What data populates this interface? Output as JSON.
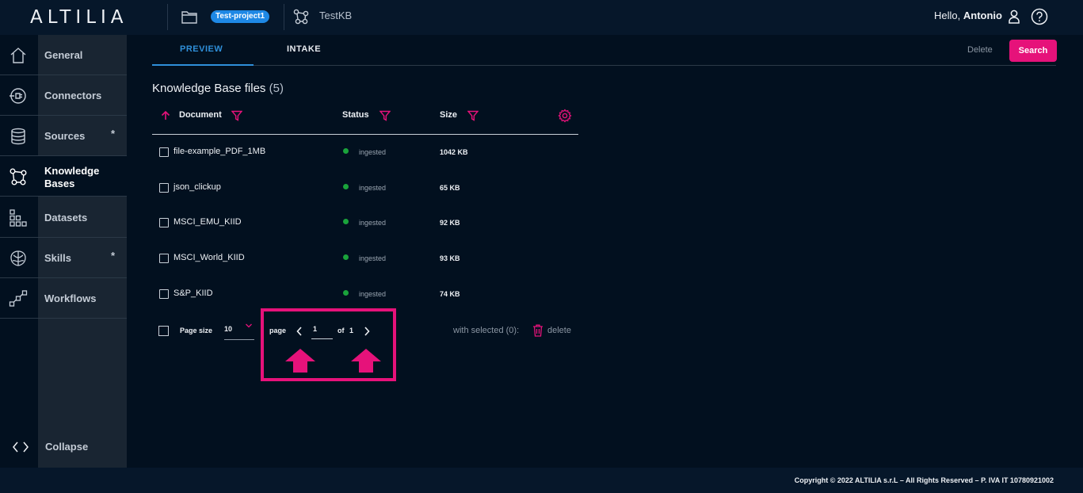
{
  "header": {
    "logo": "ALTILIA",
    "project_badge": "Test-project1",
    "kb_name": "TestKB",
    "greeting": "Hello,",
    "user_name": "Antonio"
  },
  "sidebar": {
    "items": [
      {
        "label": "General",
        "icon": "home-icon",
        "star": ""
      },
      {
        "label": "Connectors",
        "icon": "plug-icon",
        "star": ""
      },
      {
        "label": "Sources",
        "icon": "database-icon",
        "star": "*"
      },
      {
        "label": "Knowledge Bases",
        "icon": "graph-nodes-icon",
        "star": ""
      },
      {
        "label": "Datasets",
        "icon": "grid-icon",
        "star": ""
      },
      {
        "label": "Skills",
        "icon": "brain-icon",
        "star": "*"
      },
      {
        "label": "Workflows",
        "icon": "workflow-icon",
        "star": ""
      }
    ],
    "active_index": 3,
    "collapse_label": "Collapse"
  },
  "tabs": [
    {
      "label": "PREVIEW",
      "active": true
    },
    {
      "label": "INTAKE",
      "active": false
    }
  ],
  "toolbar": {
    "delete_label": "Delete",
    "search_label": "Search"
  },
  "table": {
    "title": "Knowledge Base files",
    "count": "(5)",
    "columns": {
      "document": "Document",
      "status": "Status",
      "size": "Size"
    },
    "rows": [
      {
        "document": "file-example_PDF_1MB",
        "status": "ingested",
        "size": "1042 KB"
      },
      {
        "document": "json_clickup",
        "status": "ingested",
        "size": "65 KB"
      },
      {
        "document": "MSCI_EMU_KIID",
        "status": "ingested",
        "size": "92 KB"
      },
      {
        "document": "MSCI_World_KIID",
        "status": "ingested",
        "size": "93 KB"
      },
      {
        "document": "S&P_KIID",
        "status": "ingested",
        "size": "74 KB"
      }
    ]
  },
  "pagination": {
    "page_size_label": "Page size",
    "page_size": "10",
    "page_label": "page",
    "current_page": "1",
    "of_label": "of",
    "total_pages": "1",
    "with_selected": "with selected (0):",
    "delete_label": "delete"
  },
  "footer": {
    "copyright": "Copyright © 2022 ALTILIA s.r.L – All Rights Reserved – P. IVA IT 10780921002"
  },
  "colors": {
    "accent": "#e6127a",
    "primary_blue": "#2f8fd9",
    "status_ok": "#1aa33b",
    "background": "#02101f"
  }
}
